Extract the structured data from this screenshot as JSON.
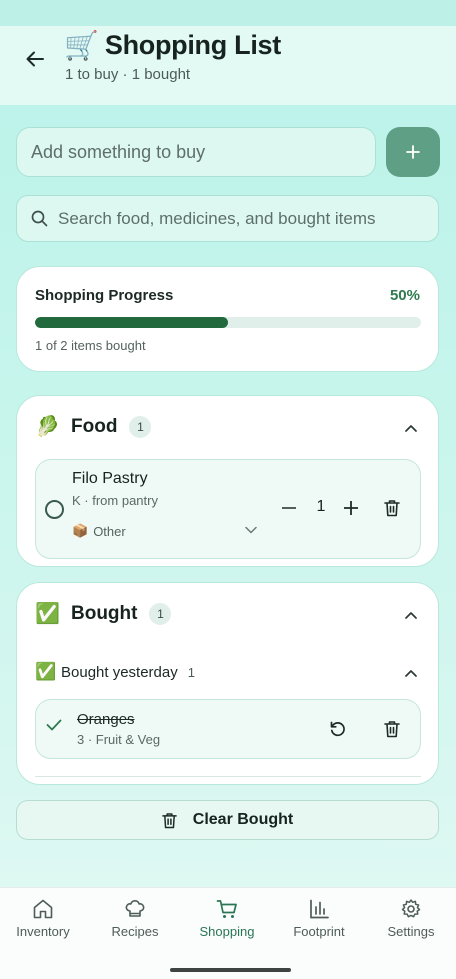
{
  "header": {
    "back_icon": "arrow-left-icon",
    "title_emoji": "🛒",
    "title": "Shopping List",
    "subtitle": "1 to buy · 1 bought"
  },
  "add": {
    "placeholder": "Add something to buy",
    "button_icon": "plus-icon",
    "button_color": "#5e9f85"
  },
  "search": {
    "placeholder": "Search food, medicines, and bought items"
  },
  "progress": {
    "title": "Shopping Progress",
    "percent_label": "50%",
    "fraction": 0.5,
    "caption": "1 of 2 items bought",
    "fill_color": "#22693d"
  },
  "sections": {
    "food": {
      "emoji": "🥬",
      "title": "Food",
      "count": "1",
      "items": [
        {
          "name": "Filo Pastry",
          "meta": "K · from pantry",
          "category_emoji": "📦",
          "category": "Other",
          "quantity": "1"
        }
      ]
    },
    "bought": {
      "emoji": "✅",
      "title": "Bought",
      "count": "1",
      "group": {
        "emoji": "✅",
        "title": "Bought yesterday",
        "count": "1"
      },
      "items": [
        {
          "name": "Oranges",
          "meta": "3 · Fruit & Veg"
        }
      ]
    }
  },
  "clear_bought": {
    "label": "Clear Bought",
    "icon": "trash-icon"
  },
  "nav": {
    "active": "Shopping",
    "active_color": "#2a7654",
    "items": [
      {
        "label": "Inventory",
        "icon": "home-icon"
      },
      {
        "label": "Recipes",
        "icon": "chef-hat-icon"
      },
      {
        "label": "Shopping",
        "icon": "cart-icon"
      },
      {
        "label": "Footprint",
        "icon": "bar-chart-icon"
      },
      {
        "label": "Settings",
        "icon": "gear-icon"
      }
    ]
  }
}
